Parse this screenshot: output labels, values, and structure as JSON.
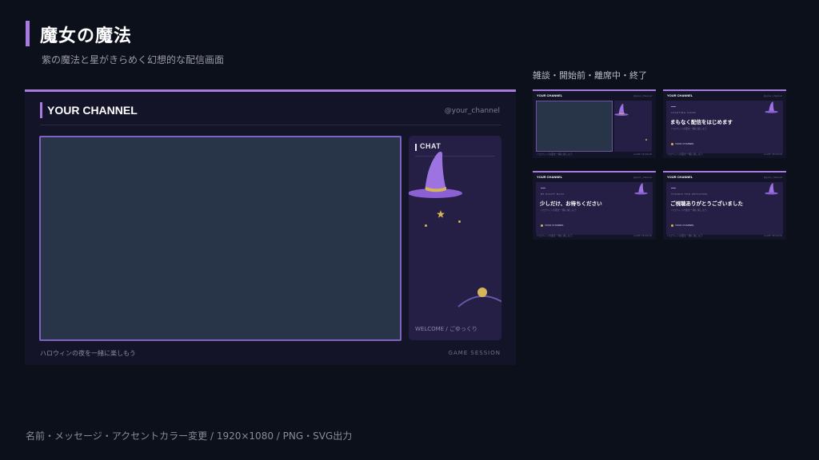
{
  "header": {
    "title": "魔女の魔法",
    "subtitle": "紫の魔法と星がきらめく幻想的な配信画面"
  },
  "variants_label": "雑談・開始前・離席中・終了",
  "preview": {
    "channel": "YOUR CHANNEL",
    "handle": "@your_channel",
    "chat_title": "CHAT",
    "chat_welcome": "WELCOME / ごゆっくり",
    "footer_left": "ハロウィンの夜を一緒に楽しもう",
    "footer_right": "GAME SESSION"
  },
  "thumbnails": [
    {
      "type": "talk",
      "channel": "YOUR CHANNEL",
      "handle": "@your_channel",
      "label": "",
      "message": ""
    },
    {
      "type": "starting",
      "channel": "YOUR CHANNEL",
      "handle": "@your_channel",
      "label": "STARTING SOON",
      "message": "まもなく配信をはじめます",
      "sub": "ハロウィンの夜を一緒に楽しもう",
      "badge": "YOUR CHANNEL"
    },
    {
      "type": "brb",
      "channel": "YOUR CHANNEL",
      "handle": "@your_channel",
      "label": "BE RIGHT BACK",
      "message": "少しだけ、お待ちください",
      "sub": "ハロウィンの夜を一緒に楽しもう",
      "badge": "YOUR CHANNEL"
    },
    {
      "type": "ending",
      "channel": "YOUR CHANNEL",
      "handle": "@your_channel",
      "label": "THANKS FOR WATCHING",
      "message": "ご視聴ありがとうございました",
      "sub": "ハロウィンの夜を一緒に楽しもう",
      "badge": "YOUR CHANNEL"
    }
  ],
  "footer": "名前・メッセージ・アクセントカラー変更 / 1920×1080 / PNG・SVG出力",
  "colors": {
    "background": "#0c101a",
    "accent": "#a77be0",
    "panel": "#141429",
    "chat": "#251f45",
    "video": "#283548",
    "star": "#d6b45a"
  },
  "icons": [
    "witch-hat-icon",
    "star-icon",
    "moon-icon"
  ]
}
